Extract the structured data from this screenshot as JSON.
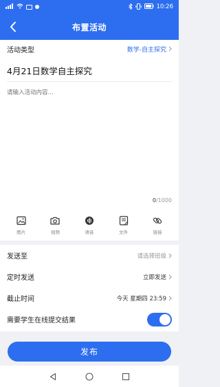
{
  "status_bar": {
    "time": "10:26"
  },
  "header": {
    "title": "布置活动",
    "back_icon": "back-chevron-icon"
  },
  "activity_type": {
    "label": "活动类型",
    "value": "数学-自主探究"
  },
  "title_field": {
    "value": "4月21日数学自主探究"
  },
  "content_field": {
    "placeholder": "请输入活动内容..."
  },
  "counter": {
    "current": "0",
    "max": "/1000"
  },
  "media_tools": [
    {
      "label": "图片",
      "icon": "image-icon"
    },
    {
      "label": "视频",
      "icon": "camera-icon"
    },
    {
      "label": "语音",
      "icon": "voice-icon"
    },
    {
      "label": "文件",
      "icon": "file-icon"
    },
    {
      "label": "链接",
      "icon": "link-icon"
    }
  ],
  "settings": {
    "send_to": {
      "label": "发送至",
      "value": "请选择班级"
    },
    "schedule": {
      "label": "定时发送",
      "value": "立即发送"
    },
    "deadline": {
      "label": "截止时间",
      "value": "今天 星期四 23:59"
    },
    "online_submit": {
      "label": "需要学生在线提交结果",
      "enabled": true
    }
  },
  "publish_button": {
    "label": "发布"
  },
  "colors": {
    "accent": "#2d6ef0",
    "background": "#f0f1f4"
  }
}
